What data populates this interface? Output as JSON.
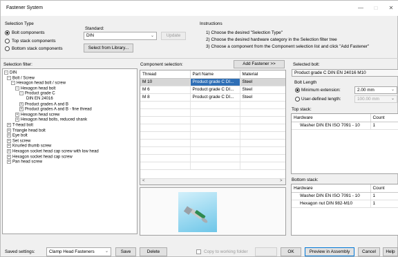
{
  "window": {
    "title": "Fastener System",
    "controls": [
      "—",
      "□",
      "✕"
    ]
  },
  "selection_type": {
    "heading": "Selection Type",
    "options": [
      {
        "label": "Bolt components",
        "selected": true
      },
      {
        "label": "Top stack components",
        "selected": false
      },
      {
        "label": "Bottom stack components",
        "selected": false
      }
    ]
  },
  "standard": {
    "label": "Standard:",
    "value": "DIN",
    "update_button": "Update",
    "library_button": "Select from Library..."
  },
  "instructions": {
    "heading": "Instructions",
    "lines": [
      "1) Choose the desired \"Selection Type\"",
      "2) Choose the desired hardware category in the Selection filter tree",
      "3) Choose a component from the Component selection list and click \"Add Fastener\""
    ]
  },
  "selection_filter": {
    "heading": "Selection filter:",
    "tree": [
      {
        "label": "DIN",
        "exp": "−"
      },
      {
        "label": "Bolt / Screw",
        "exp": "−"
      },
      {
        "label": "Hexagon head bolt / screw",
        "exp": "−"
      },
      {
        "label": "Hexagon head bolt",
        "exp": "−"
      },
      {
        "label": "Product grade C",
        "exp": "−"
      },
      {
        "label": "DIN EN 24016",
        "exp": ""
      },
      {
        "label": "Product grades A and B",
        "exp": "+"
      },
      {
        "label": "Product grades A and B - fine thread",
        "exp": "+"
      },
      {
        "label": "Hexagon head screw",
        "exp": "+"
      },
      {
        "label": "Hexagon head bolts, reduced shank",
        "exp": "+"
      },
      {
        "label": "T-head bolt",
        "exp": "+"
      },
      {
        "label": "Triangle head bolt",
        "exp": "+"
      },
      {
        "label": "Eye bolt",
        "exp": "+"
      },
      {
        "label": "Set screw",
        "exp": "+"
      },
      {
        "label": "Knurled thumb screw",
        "exp": "+"
      },
      {
        "label": "Hexagon socket head cap screw with low head",
        "exp": "+"
      },
      {
        "label": "Hexagon socket head cap screw",
        "exp": "+"
      },
      {
        "label": "Pan head screw",
        "exp": "+"
      }
    ]
  },
  "component_selection": {
    "heading": "Component selection:",
    "add_button": "Add Fastener >>",
    "columns": [
      "Thread",
      "Part Name",
      "Material"
    ],
    "rows": [
      [
        "M 10",
        "Product grade C DI...",
        "Steel"
      ],
      [
        "M 6",
        "Product grade C DI...",
        "Steel"
      ],
      [
        "M 8",
        "Product grade C DI...",
        "Steel"
      ]
    ],
    "scroll_left": "<",
    "scroll_right": ">"
  },
  "selected_bolt": {
    "heading": "Selected bolt:",
    "value": "Product grade C DIN EN 24016 M10",
    "bolt_length_heading": "Bolt Length",
    "minimum_extension_label": "Minimum extension:",
    "minimum_extension_value": "2.00 mm",
    "user_defined_label": "User-defined length:",
    "user_defined_value": "100.00 mm"
  },
  "top_stack": {
    "heading": "Top stack:",
    "columns": [
      "Hardware",
      "Count"
    ],
    "rows": [
      [
        "Washer DIN EN ISO 7091 - 10",
        "1"
      ]
    ]
  },
  "bottom_stack": {
    "heading": "Bottom stack:",
    "columns": [
      "Hardware",
      "Count"
    ],
    "rows": [
      [
        "Washer DIN EN ISO 7091 - 10",
        "1"
      ],
      [
        "Hexagon nut DIN 982-M10",
        "1"
      ]
    ]
  },
  "footer": {
    "saved_settings_label": "Saved settings:",
    "saved_settings_value": "Clamp Head Fasteners",
    "save_button": "Save",
    "delete_button": "Delete",
    "copy_label": "Copy to working folder",
    "ok_button": "OK",
    "preview_button": "Preview in Assembly",
    "cancel_button": "Cancel",
    "help_button": "Help"
  },
  "colors": {
    "selection_blue": "#2f6fb6",
    "accent": "#0078d7"
  }
}
